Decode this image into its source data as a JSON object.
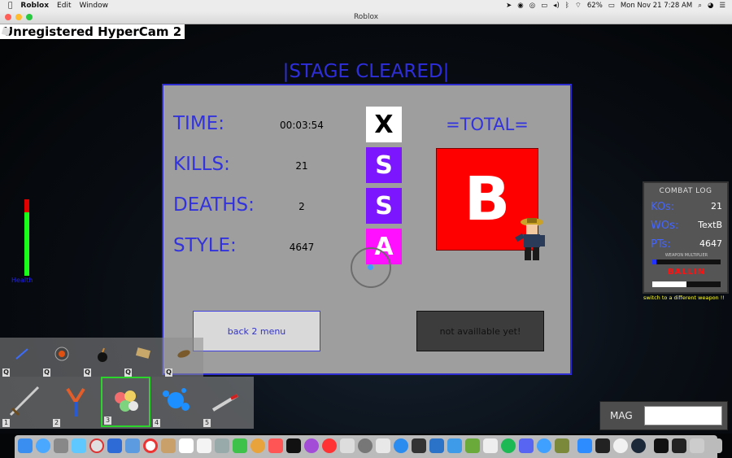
{
  "menubar": {
    "apple": "",
    "app": "Roblox",
    "items": [
      "Edit",
      "Window"
    ],
    "battery": "62%",
    "datetime": "Mon Nov 21  7:28 AM"
  },
  "window": {
    "title": "Roblox"
  },
  "watermark": "Unregistered HyperCam 2",
  "stage": {
    "title": "|STAGE CLEARED|",
    "stats": [
      {
        "label": "TIME:",
        "value": "00:03:54",
        "grade": "X",
        "grade_bg": "#ffffff",
        "grade_fg": "#000000"
      },
      {
        "label": "KILLS:",
        "value": "21",
        "grade": "S",
        "grade_bg": "#7b16ff",
        "grade_fg": "#ffffff"
      },
      {
        "label": "DEATHS:",
        "value": "2",
        "grade": "S",
        "grade_bg": "#7b16ff",
        "grade_fg": "#ffffff"
      },
      {
        "label": "STYLE:",
        "value": "4647",
        "grade": "A",
        "grade_bg": "#ff10ff",
        "grade_fg": "#ffffff"
      }
    ],
    "total_label": "=TOTAL=",
    "total_grade": "B",
    "back_button": "back 2 menu",
    "na_button": "not availlable yet!"
  },
  "health": {
    "label": "Health",
    "fraction": 0.83
  },
  "combat_log": {
    "title": "COMBAT LOG",
    "rows": [
      {
        "key": "KOs:",
        "value": "21"
      },
      {
        "key": "WOs:",
        "value": "TextB"
      },
      {
        "key": "PTs:",
        "value": "4647"
      }
    ],
    "multiplier_label": "WEAPON MULTIPLIER",
    "status": "BALLIN",
    "tip": "switch to a different weapon !!"
  },
  "hotbar_top": {
    "key_label": "Q",
    "slots": 5
  },
  "hotbar": {
    "slots": [
      {
        "num": "1",
        "selected": false
      },
      {
        "num": "2",
        "selected": false
      },
      {
        "num": "3",
        "selected": true
      },
      {
        "num": "4",
        "selected": false
      },
      {
        "num": "5",
        "selected": false
      }
    ]
  },
  "mag": {
    "label": "MAG",
    "value": ""
  },
  "colors": {
    "accent_blue": "#3333dd",
    "total_red": "#ff0000",
    "panel_gray": "#9e9e9e"
  }
}
